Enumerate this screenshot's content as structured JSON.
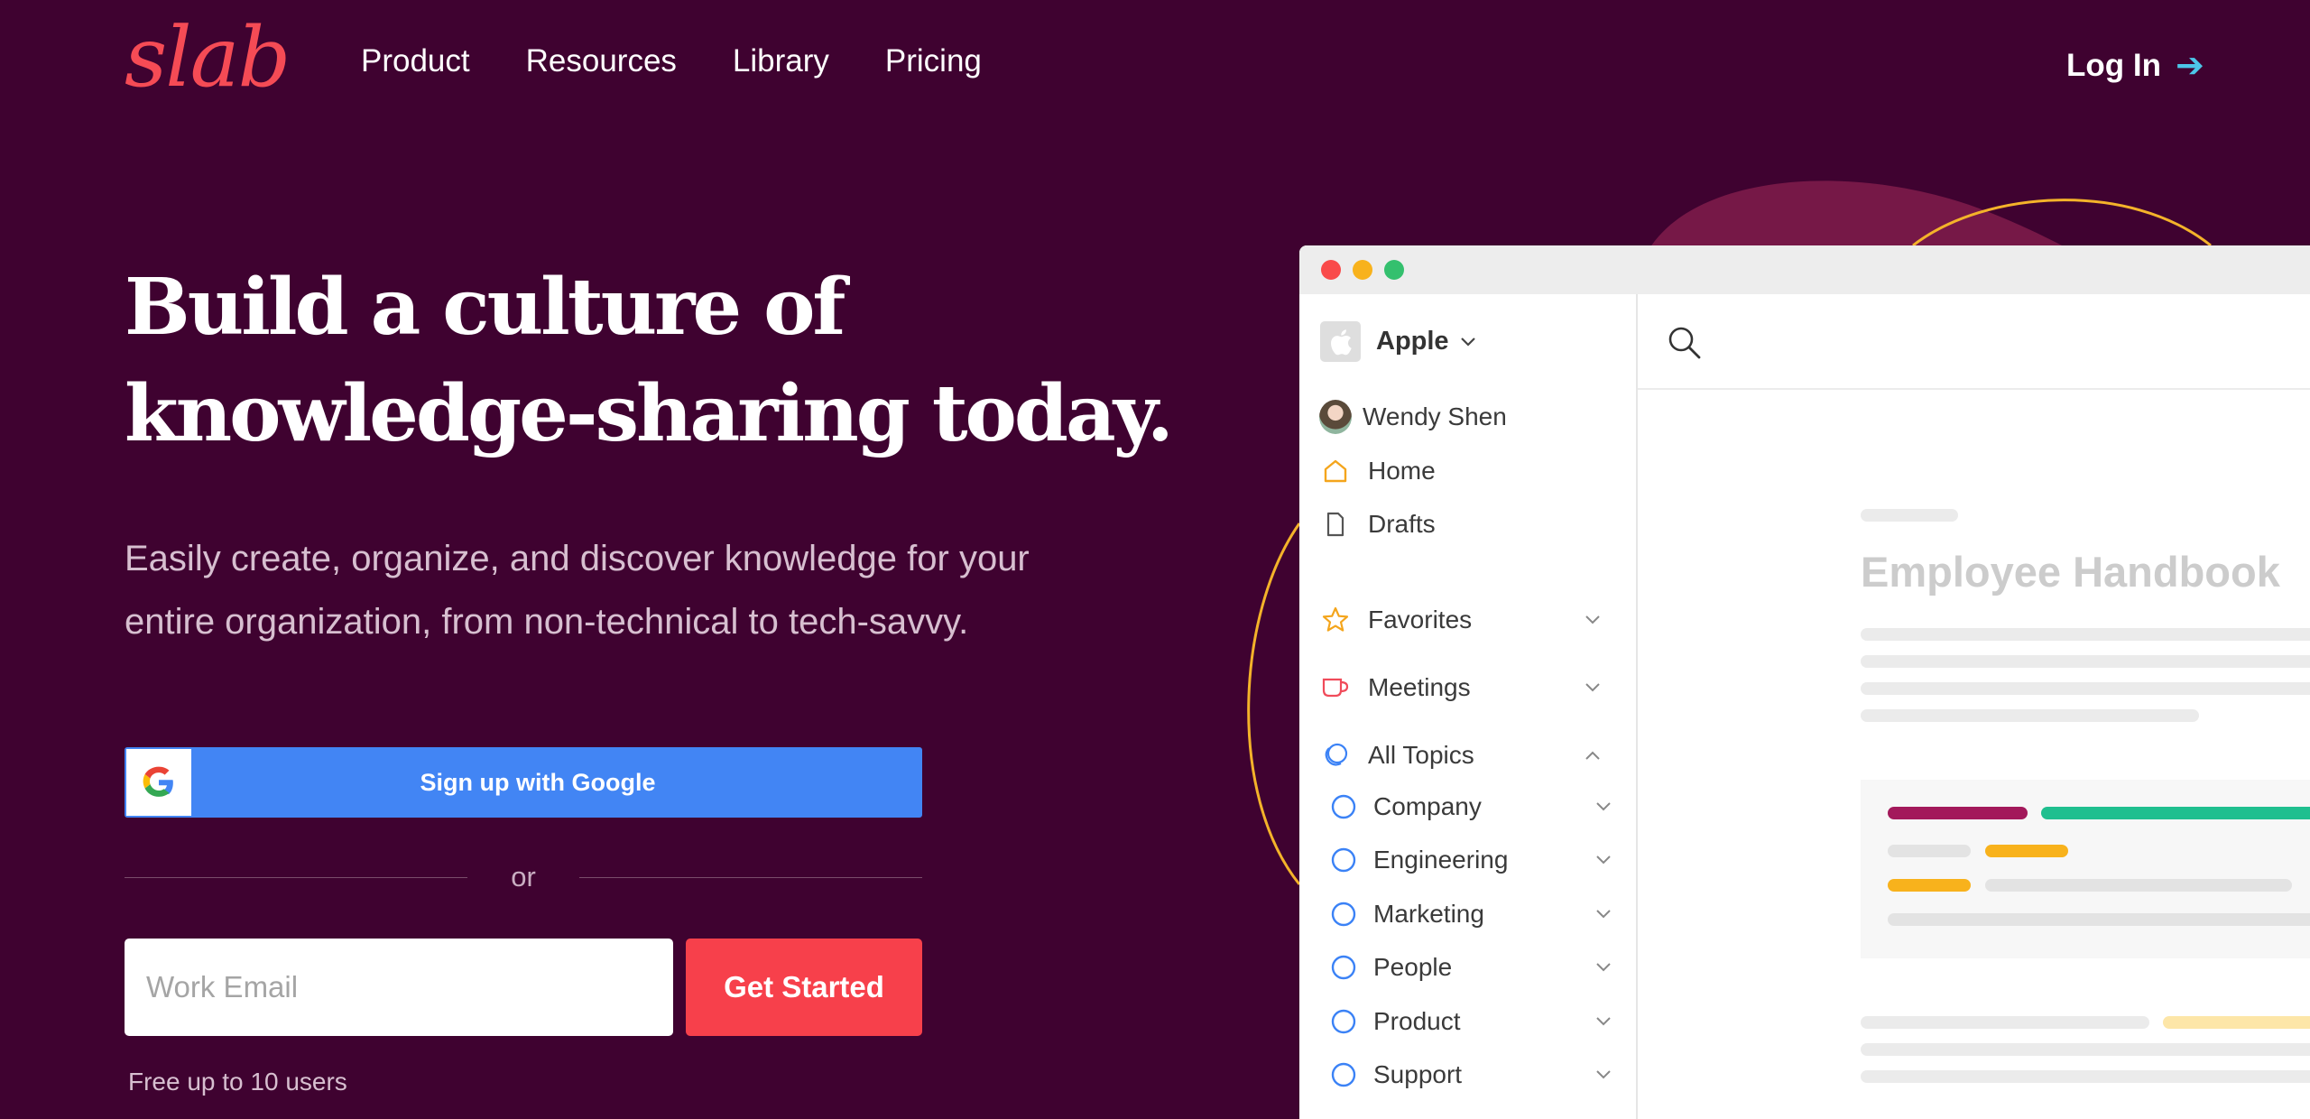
{
  "brand": {
    "logo_text": "slab",
    "logo_color": "#f54b55"
  },
  "nav": {
    "items": [
      {
        "label": "Product"
      },
      {
        "label": "Resources"
      },
      {
        "label": "Library"
      },
      {
        "label": "Pricing"
      }
    ],
    "login_label": "Log In",
    "login_arrow": "➔"
  },
  "hero": {
    "title_line1": "Build a culture of",
    "title_line2": "knowledge-sharing today.",
    "subtitle_line1": "Easily create, organize, and discover knowledge for your",
    "subtitle_line2": "entire organization, from non-technical to tech-savvy."
  },
  "signup": {
    "google_label": "Sign up with Google",
    "or_text": "or",
    "email_placeholder": "Work Email",
    "email_value": "",
    "cta_label": "Get Started",
    "note": "Free up to 10 users"
  },
  "colors": {
    "background": "#3f0230",
    "google_blue": "#4285f4",
    "cta_red": "#f7404b",
    "login_arrow": "#4cc6e8",
    "deco_blob": "#761847",
    "deco_line": "#f4b32a",
    "window_dots": [
      "#f94a4a",
      "#f8b21c",
      "#34c06e"
    ],
    "topic_icon": "#3b82f6"
  },
  "app_mock": {
    "workspace_name": "Apple",
    "user_name": "Wendy Shen",
    "sidebar": {
      "home": "Home",
      "drafts": "Drafts",
      "favorites": "Favorites",
      "meetings": "Meetings",
      "all_topics": "All Topics",
      "topics": [
        {
          "label": "Company"
        },
        {
          "label": "Engineering"
        },
        {
          "label": "Marketing"
        },
        {
          "label": "People"
        },
        {
          "label": "Product"
        },
        {
          "label": "Support"
        }
      ]
    },
    "doc_title": "Employee Handbook",
    "icons": {
      "search": "search-icon",
      "home": "home-icon",
      "drafts": "document-icon",
      "favorites": "star-icon",
      "meetings": "coffee-cup-icon",
      "all_topics": "topics-icon",
      "topic": "circle-icon",
      "chevron": "chevron-down-icon"
    }
  }
}
